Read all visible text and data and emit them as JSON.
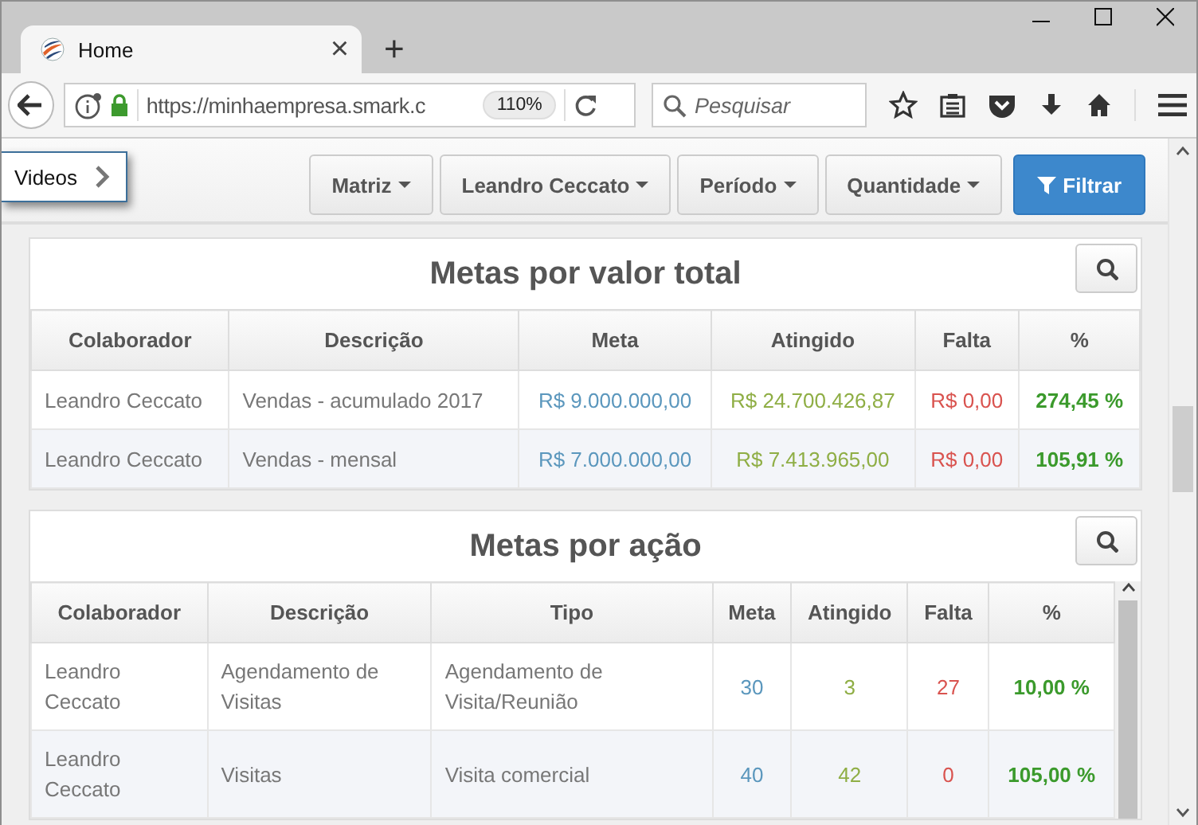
{
  "browser": {
    "tab": {
      "title": "Home",
      "close": "×"
    },
    "new_tab": "+",
    "url": "https://minhaempresa.smark.c",
    "zoom": "110%",
    "search": {
      "placeholder": "Pesquisar"
    }
  },
  "sidebar_toggle": {
    "label": "Videos"
  },
  "filters": [
    {
      "label": "Matriz",
      "kind": "dropdown"
    },
    {
      "label": "Leandro Ceccato",
      "kind": "dropdown"
    },
    {
      "label": "Período",
      "kind": "dropdown"
    },
    {
      "label": "Quantidade",
      "kind": "dropdown"
    },
    {
      "label": "Filtrar",
      "kind": "primary"
    }
  ],
  "panels": [
    {
      "title": "Metas por valor total",
      "scrollable": false,
      "columns": [
        {
          "label": "Colaborador",
          "kind": "name"
        },
        {
          "label": "Descrição",
          "kind": "text"
        },
        {
          "label": "Meta",
          "kind": "target"
        },
        {
          "label": "Atingido",
          "kind": "achieved"
        },
        {
          "label": "Falta",
          "kind": "missing"
        },
        {
          "label": "%",
          "kind": "percent"
        }
      ],
      "rows": [
        [
          "Leandro Ceccato",
          "Vendas - acumulado 2017",
          "R$ 9.000.000,00",
          "R$ 24.700.426,87",
          "R$ 0,00",
          "274,45 %"
        ],
        [
          "Leandro Ceccato",
          "Vendas - mensal",
          "R$ 7.000.000,00",
          "R$ 7.413.965,00",
          "R$ 0,00",
          "105,91 %"
        ]
      ]
    },
    {
      "title": "Metas por ação",
      "scrollable": true,
      "columns": [
        {
          "label": "Colaborador",
          "kind": "name"
        },
        {
          "label": "Descrição",
          "kind": "text"
        },
        {
          "label": "Tipo",
          "kind": "text"
        },
        {
          "label": "Meta",
          "kind": "target"
        },
        {
          "label": "Atingido",
          "kind": "achieved"
        },
        {
          "label": "Falta",
          "kind": "missing"
        },
        {
          "label": "%",
          "kind": "percent"
        }
      ],
      "rows": [
        [
          "Leandro Ceccato",
          "Agendamento de Visitas",
          "Agendamento de Visita/Reunião",
          "30",
          "3",
          "27",
          "10,00 %"
        ],
        [
          "Leandro Ceccato",
          "Visitas",
          "Visita comercial",
          "40",
          "42",
          "0",
          "105,00 %"
        ]
      ]
    }
  ]
}
